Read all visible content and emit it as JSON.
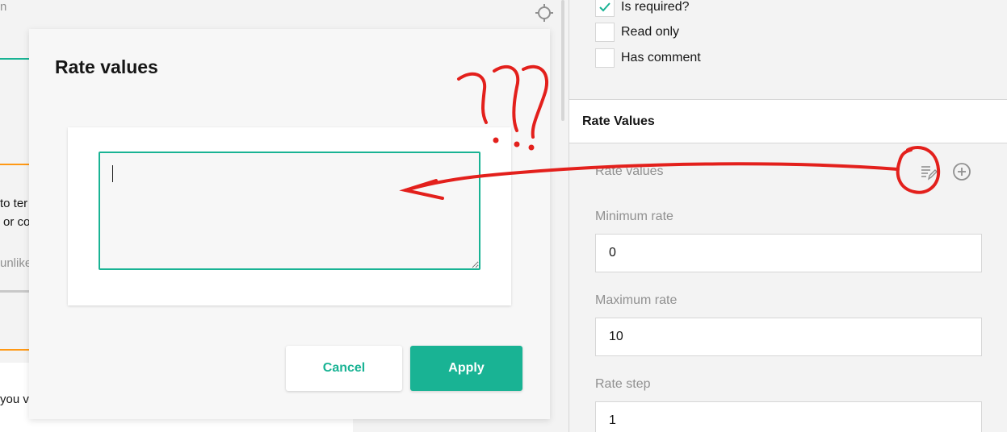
{
  "background": {
    "fragments": [
      "n",
      "to ter",
      "or co",
      "unlike",
      "you va"
    ]
  },
  "modal": {
    "title": "Rate values",
    "textarea_value": "",
    "cancel_label": "Cancel",
    "apply_label": "Apply"
  },
  "panel": {
    "checkboxes": [
      {
        "label": "Is required?",
        "checked": true
      },
      {
        "label": "Read only",
        "checked": false
      },
      {
        "label": "Has comment",
        "checked": false
      }
    ],
    "section_title": "Rate Values",
    "rate_values_label": "Rate values",
    "min_rate_label": "Minimum rate",
    "min_rate_value": "0",
    "max_rate_label": "Maximum rate",
    "max_rate_value": "10",
    "rate_step_label": "Rate step",
    "rate_step_value": "1"
  },
  "annotation": {
    "text": "???"
  },
  "colors": {
    "accent": "#19b394",
    "orange": "#ff9814",
    "annotation_red": "#e3201c"
  },
  "icons": [
    "crosshair-icon",
    "checkmark-icon",
    "edit-list-icon",
    "add-circle-icon",
    "arrow-annotation",
    "question-marks-annotation"
  ]
}
